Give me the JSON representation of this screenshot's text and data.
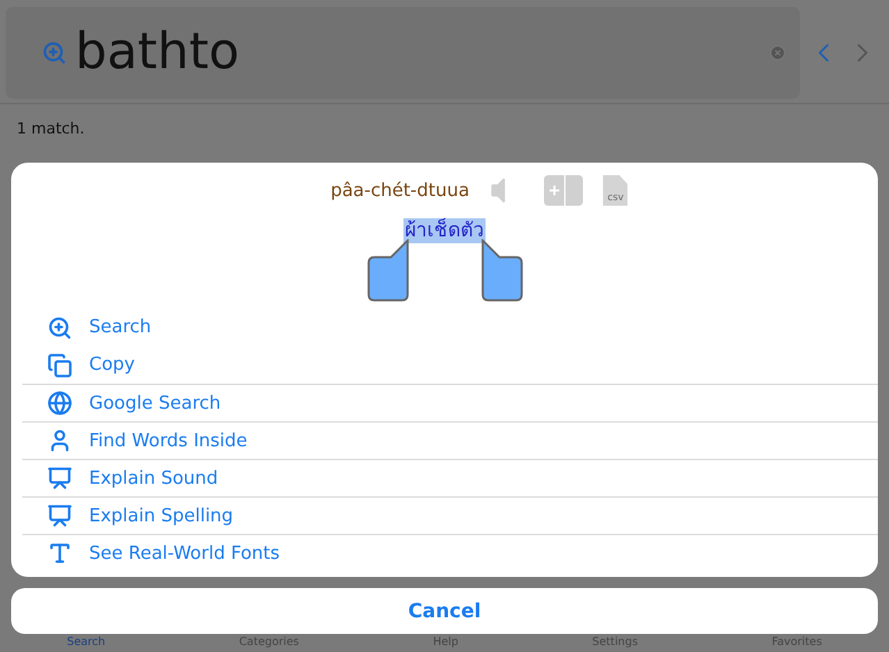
{
  "search": {
    "value": "bathto"
  },
  "nav_buttons": [
    {
      "kind": "previous",
      "disabled": false
    },
    {
      "kind": "next",
      "disabled": true
    }
  ],
  "status": "1 match.",
  "popup": {
    "romanization": "pâa-chét-dtuua",
    "tools": [
      {
        "kind": "speaker",
        "disabled": true
      },
      {
        "kind": "add",
        "disabled": true
      },
      {
        "kind": "export",
        "label": "csv",
        "disabled": true
      }
    ],
    "thai_word": "ผ้าเช็ดตัว",
    "actions": [
      {
        "kind": "search",
        "label": "Search"
      },
      {
        "kind": "copy",
        "label": "Copy"
      },
      {
        "kind": "globe",
        "label": "Google Search"
      },
      {
        "kind": "person",
        "label": "Find Words Inside"
      },
      {
        "kind": "explain",
        "label": "Explain Sound"
      },
      {
        "kind": "explain",
        "label": "Explain Spelling"
      },
      {
        "kind": "font",
        "label": "See Real-World Fonts"
      }
    ]
  },
  "cancel": "Cancel",
  "tab_bar": [
    {
      "label": "Search",
      "selected": true
    },
    {
      "label": "Categories",
      "selected": false
    },
    {
      "label": "Help",
      "selected": false
    },
    {
      "label": "Settings",
      "selected": false
    },
    {
      "label": "Favorites",
      "selected": false
    }
  ]
}
